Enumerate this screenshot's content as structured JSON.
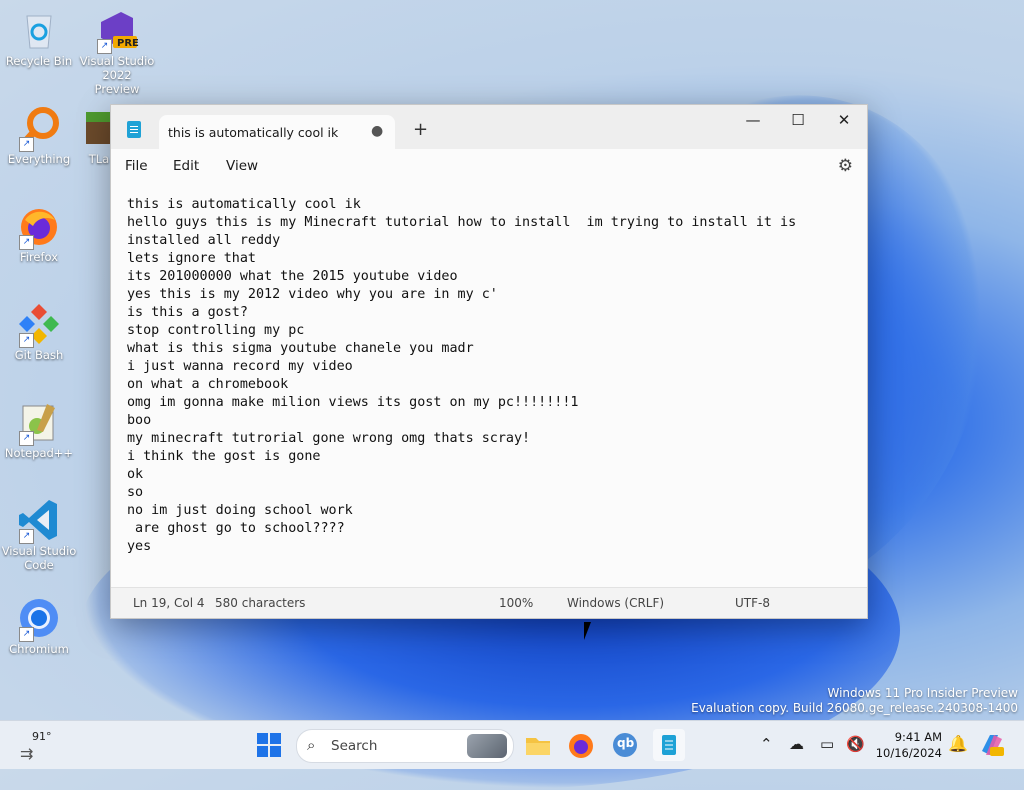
{
  "desktop": {
    "icons": [
      {
        "label": "Recycle Bin"
      },
      {
        "label": "Visual Studio 2022 Preview",
        "badge": "PRE"
      },
      {
        "label": "Everything"
      },
      {
        "label": "TLa"
      },
      {
        "label": "Firefox"
      },
      {
        "label": "Git Bash"
      },
      {
        "label": "Notepad++"
      },
      {
        "label": "Visual Studio Code"
      },
      {
        "label": "Chromium"
      }
    ]
  },
  "window": {
    "tab_title": "this is automatically cool ik",
    "tab_modified_dot": "●",
    "new_tab": "+",
    "controls": {
      "minimize": "—",
      "maximize": "☐",
      "close": "✕"
    },
    "menu": [
      "File",
      "Edit",
      "View"
    ],
    "content": "this is automatically cool ik\nhello guys this is my Minecraft tutorial how to install  im trying to install it is\ninstalled all reddy\nlets ignore that\nits 201000000 what the 2015 youtube video\nyes this is my 2012 video why you are in my c'\nis this a gost?\nstop controlling my pc\nwhat is this sigma youtube chanele you madr\ni just wanna record my video\non what a chromebook\nomg im gonna make milion views its gost on my pc!!!!!!!1\nboo\nmy minecraft tutrorial gone wrong omg thats scray!\ni think the gost is gone\nok\nso\nno im just doing school work\n are ghost go to school????\nyes",
    "status": {
      "position": "Ln 19, Col 4",
      "characters": "580 characters",
      "zoom": "100%",
      "line_ending": "Windows (CRLF)",
      "encoding": "UTF-8"
    }
  },
  "watermark": {
    "line1": "Windows 11 Pro Insider Preview",
    "line2": "Evaluation copy. Build 26080.ge_release.240308-1400"
  },
  "taskbar": {
    "weather": "91°",
    "search_label": "Search",
    "time": "9:41 AM",
    "date": "10/16/2024",
    "apps": [
      "File Explorer",
      "Firefox",
      "qBittorrent",
      "Notepad"
    ],
    "qb_label": "qb"
  },
  "colors": {
    "accent": "#1e73e8",
    "window_bg": "#fbfbfb"
  }
}
